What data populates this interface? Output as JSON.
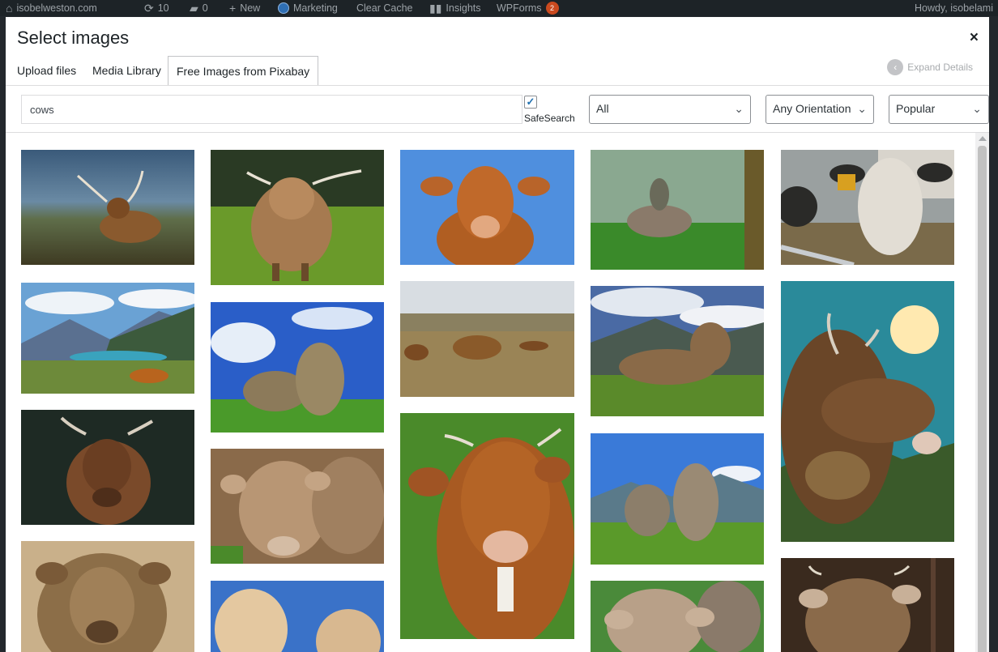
{
  "adminbar": {
    "site": "isobelweston.com",
    "updates": "10",
    "comments": "0",
    "new": "New",
    "marketing": "Marketing",
    "clear_cache": "Clear Cache",
    "insights": "Insights",
    "wpforms": "WPForms",
    "wpforms_badge": "2",
    "howdy": "Howdy, isobelami"
  },
  "modal": {
    "title": "Select images",
    "close": "×",
    "expand_details": "Expand Details",
    "tabs": [
      {
        "label": "Upload files"
      },
      {
        "label": "Media Library"
      },
      {
        "label": "Free Images from Pixabay"
      }
    ]
  },
  "filters": {
    "search_value": "cows",
    "safesearch_label": "SafeSearch",
    "safesearch_checked": true,
    "type_value": "All",
    "orientation_value": "Any Orientation",
    "order_value": "Popular"
  },
  "images": [
    {
      "alt": "highland cow lying in mountain grass"
    },
    {
      "alt": "highland cow standing in meadow"
    },
    {
      "alt": "brown cow against blue sky"
    },
    {
      "alt": "person riding cow in green field"
    },
    {
      "alt": "white-faced cow behind fence"
    },
    {
      "alt": "cow lying near alpine lake"
    },
    {
      "alt": "cows grazing under blue sky"
    },
    {
      "alt": "highland cattle in grassland"
    },
    {
      "alt": "cow lying in alpine meadow"
    },
    {
      "alt": "cow with bell under sun"
    },
    {
      "alt": "brown cow portrait dark background"
    },
    {
      "alt": "brown cows with ear tags"
    },
    {
      "alt": "brown and white cow close-up"
    },
    {
      "alt": "cows grazing in mountains"
    },
    {
      "alt": "sepia cow portrait"
    },
    {
      "alt": "light cows against sky"
    },
    {
      "alt": "cows in green pasture"
    },
    {
      "alt": "cow in barn"
    }
  ]
}
